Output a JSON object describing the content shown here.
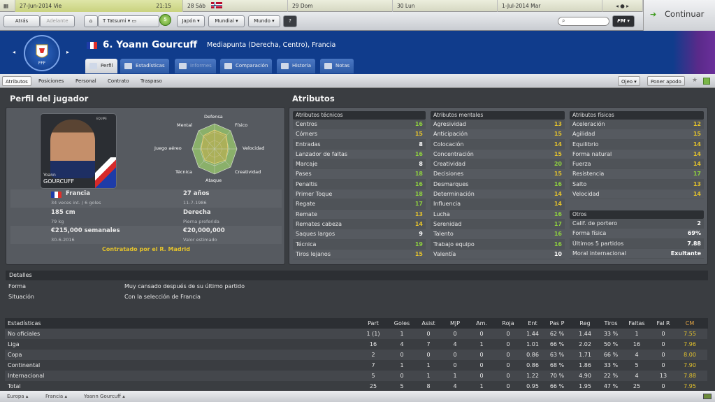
{
  "calendar": {
    "current_date": "27-Jun-2014 Vie",
    "current_time": "21:15",
    "days": [
      "28 Sáb",
      "29 Dom",
      "30 Lun",
      "1-Jul-2014 Mar"
    ]
  },
  "nav": {
    "back": "Atrás",
    "forward": "Adelante",
    "manager": "T Tatsumi",
    "notifications": "5",
    "menu_japan": "Japón",
    "menu_world_cup": "Mundial",
    "menu_world": "Mundo",
    "help": "?",
    "fm_menu": "FM",
    "continue": "Continuar"
  },
  "player": {
    "number_name": "6. Yoann Gourcuff",
    "subtitle": "Mediapunta (Derecha, Centro), Francia",
    "card_first": "Yoann",
    "card_last": "GOURCUFF",
    "card_logo": "EQUIPE"
  },
  "tabs": [
    {
      "label": "Perfil"
    },
    {
      "label": "Estadísticas"
    },
    {
      "label": "Informes"
    },
    {
      "label": "Comparación"
    },
    {
      "label": "Historia"
    },
    {
      "label": "Notas"
    }
  ],
  "subnav": {
    "items": [
      "Atributos",
      "Posiciones",
      "Personal",
      "Contrato",
      "Traspaso"
    ],
    "scout": "Ojeo",
    "nickname": "Poner apodo"
  },
  "profile": {
    "title": "Perfil del jugador",
    "radar": [
      "Defensa",
      "Físico",
      "Velocidad",
      "Creatividad",
      "Ataque",
      "Técnica",
      "Juego aéreo",
      "Mental"
    ],
    "nation": "Francia",
    "caps": "34 veces int. / 6 goles",
    "age": "27 años",
    "dob": "11-7-1986",
    "height": "185 cm",
    "weight": "79 kg",
    "foot": "Derecha",
    "foot_label": "Pierna preferida",
    "wage": "€215,000 semanales",
    "contract_end": "30-6-2016",
    "value": "€20,000,000",
    "value_label": "Valor estimado",
    "contract_text": "Contratado por el R. Madrid"
  },
  "attributes": {
    "title": "Atributos",
    "technical": {
      "header": "Atributos técnicos",
      "rows": [
        {
          "name": "Centros",
          "value": "16"
        },
        {
          "name": "Córners",
          "value": "15"
        },
        {
          "name": "Entradas",
          "value": "8"
        },
        {
          "name": "Lanzador de faltas",
          "value": "16"
        },
        {
          "name": "Marcaje",
          "value": "8"
        },
        {
          "name": "Pases",
          "value": "18"
        },
        {
          "name": "Penaltis",
          "value": "16"
        },
        {
          "name": "Primer Toque",
          "value": "18"
        },
        {
          "name": "Regate",
          "value": "17"
        },
        {
          "name": "Remate",
          "value": "13"
        },
        {
          "name": "Remates cabeza",
          "value": "14"
        },
        {
          "name": "Saques largos",
          "value": "9"
        },
        {
          "name": "Técnica",
          "value": "19"
        },
        {
          "name": "Tiros lejanos",
          "value": "15"
        }
      ]
    },
    "mental": {
      "header": "Atributos mentales",
      "rows": [
        {
          "name": "Agresividad",
          "value": "13"
        },
        {
          "name": "Anticipación",
          "value": "15"
        },
        {
          "name": "Colocación",
          "value": "14"
        },
        {
          "name": "Concentración",
          "value": "15"
        },
        {
          "name": "Creatividad",
          "value": "20"
        },
        {
          "name": "Decisiones",
          "value": "15"
        },
        {
          "name": "Desmarques",
          "value": "16"
        },
        {
          "name": "Determinación",
          "value": "14"
        },
        {
          "name": "Influencia",
          "value": "14"
        },
        {
          "name": "Lucha",
          "value": "16"
        },
        {
          "name": "Serenidad",
          "value": "17"
        },
        {
          "name": "Talento",
          "value": "16"
        },
        {
          "name": "Trabajo equipo",
          "value": "16"
        },
        {
          "name": "Valentía",
          "value": "10"
        }
      ]
    },
    "physical": {
      "header": "Atributos físicos",
      "rows": [
        {
          "name": "Aceleración",
          "value": "12"
        },
        {
          "name": "Agilidad",
          "value": "15"
        },
        {
          "name": "Equilibrio",
          "value": "14"
        },
        {
          "name": "Forma natural",
          "value": "14"
        },
        {
          "name": "Fuerza",
          "value": "14"
        },
        {
          "name": "Resistencia",
          "value": "17"
        },
        {
          "name": "Salto",
          "value": "13"
        },
        {
          "name": "Velocidad",
          "value": "14"
        }
      ]
    },
    "others": {
      "header": "Otros",
      "rows": [
        {
          "name": "Calif. de portero",
          "value": "2"
        },
        {
          "name": "Forma física",
          "value": "69%"
        },
        {
          "name": "Últimos 5 partidos",
          "value": "7.88"
        },
        {
          "name": "Moral internacional",
          "value": "Exultante"
        }
      ]
    }
  },
  "details": {
    "title": "Detalles",
    "rows": [
      {
        "label": "Forma",
        "value": "Muy cansado después de su último partido"
      },
      {
        "label": "Situación",
        "value": "Con la selección de Francia"
      }
    ]
  },
  "stats": {
    "title": "Estadísticas",
    "columns": [
      "Part",
      "Goles",
      "Asist",
      "MJP",
      "Am.",
      "Roja",
      "Ent",
      "Pas P",
      "Reg",
      "Tiros",
      "Faltas",
      "Fal R",
      "CM"
    ],
    "rows": [
      {
        "label": "No oficiales",
        "cells": [
          "1 (1)",
          "1",
          "0",
          "0",
          "0",
          "0",
          "1.44",
          "62 %",
          "1.44",
          "33 %",
          "1",
          "0",
          "7.55"
        ]
      },
      {
        "label": "Liga",
        "cells": [
          "16",
          "4",
          "7",
          "4",
          "1",
          "0",
          "1.01",
          "66 %",
          "2.02",
          "50 %",
          "16",
          "0",
          "7.96"
        ]
      },
      {
        "label": "Copa",
        "cells": [
          "2",
          "0",
          "0",
          "0",
          "0",
          "0",
          "0.86",
          "63 %",
          "1.71",
          "66 %",
          "4",
          "0",
          "8.00"
        ]
      },
      {
        "label": "Continental",
        "cells": [
          "7",
          "1",
          "1",
          "0",
          "0",
          "0",
          "0.86",
          "68 %",
          "1.86",
          "33 %",
          "5",
          "0",
          "7.90"
        ]
      },
      {
        "label": "Internacional",
        "cells": [
          "5",
          "0",
          "1",
          "1",
          "0",
          "0",
          "1.22",
          "70 %",
          "4.90",
          "22 %",
          "4",
          "13",
          "7.88"
        ]
      },
      {
        "label": "Total",
        "cells": [
          "25",
          "5",
          "8",
          "4",
          "1",
          "0",
          "0.95",
          "66 %",
          "1.95",
          "47 %",
          "25",
          "0",
          "7.95"
        ]
      }
    ]
  },
  "footer": {
    "crumbs": [
      "Europa",
      "Francia",
      "Yoann Gourcuff"
    ]
  }
}
